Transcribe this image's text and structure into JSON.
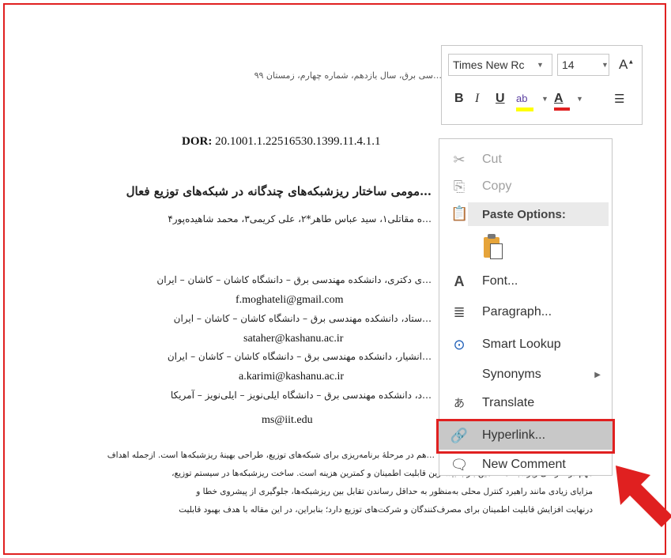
{
  "document": {
    "journal_header": "…سی برق، سال یازدهم، شماره چهارم، زمستان ۹۹",
    "dor_label": "DOR:",
    "dor_value": "20.1001.1.22516530.1399.11.4.1.1",
    "title": "…مومی ساختار ریزشبکه‌های چندگانه در شبکه‌های توزیع فعال",
    "authors": "…ه مقاتلی۱، سید عباس طاهر*۲، علی کریمی۳، محمد شاهیده‌پور۴",
    "affiliations": [
      {
        "text": "…ی دکتری، دانشکده مهندسی برق – دانشگاه کاشان – کاشان – ایران",
        "email": "f.moghateli@gmail.com"
      },
      {
        "text": "…ستاد، دانشکده مهندسی برق – دانشگاه کاشان – کاشان – ایران",
        "email": "sataher@kashanu.ac.ir"
      },
      {
        "text": "…انشیار، دانشکده مهندسی برق – دانشگاه کاشان – کاشان – ایران",
        "email": "a.karimi@kashanu.ac.ir"
      },
      {
        "text": "…د، دانشکده مهندسی برق – دانشگاه ایلی‌نویز – ایلی‌نویز – آمریکا",
        "email": "ms@iit.edu"
      }
    ],
    "abstract_lines": [
      "…هم در مرحلهٔ برنامه‌ریزی برای شبکه‌های توزیع، طراحی بهینهٔ ریزشبکه‌ها است. ازجمله اهداف",
      "مهم در طراحی ریزشبکه‌ها، تأمین بار با بیشترین قابلیت اطمینان و کمترین هزینه است. ساخت ریزشبکه‌ها در سیستم توزیع،",
      "مزایای زیادی مانند راهبرد کنترل محلی به‌منظور به حداقل رساندن تقابل بین ریزشبکه‌ها، جلوگیری از پیشروی خطا و",
      "درنهایت افزایش قابلیت اطمینان برای مصرف‌کنندگان و شرکت‌های توزیع دارد؛ بنابراین، در این مقاله با هدف بهبود قابلیت"
    ]
  },
  "mini_toolbar": {
    "font_name": "Times New Rc",
    "font_size": "14",
    "grow_font": "A",
    "bold": "B",
    "italic": "I",
    "underline": "U",
    "highlight": "ab",
    "font_color": "A",
    "highlight_color": "#ffff00",
    "font_color_value": "#e02020"
  },
  "context_menu": {
    "items": [
      {
        "label": "Cut",
        "icon": "scissors-icon",
        "enabled": false
      },
      {
        "label": "Copy",
        "icon": "copy-icon",
        "enabled": false
      },
      {
        "label": "Paste Options:",
        "icon": "paste-icon",
        "header": true
      },
      {
        "label": "Font...",
        "icon": "font-icon",
        "enabled": true
      },
      {
        "label": "Paragraph...",
        "icon": "paragraph-icon",
        "enabled": true
      },
      {
        "label": "Smart Lookup",
        "icon": "smart-lookup-icon",
        "enabled": true
      },
      {
        "label": "Synonyms",
        "icon": "",
        "enabled": true,
        "submenu": true
      },
      {
        "label": "Translate",
        "icon": "translate-icon",
        "enabled": true
      },
      {
        "label": "Hyperlink...",
        "icon": "hyperlink-icon",
        "enabled": true,
        "highlighted": true
      },
      {
        "label": "New Comment",
        "icon": "comment-icon",
        "enabled": true
      }
    ]
  },
  "annotation": {
    "highlight_color": "#e02020"
  }
}
